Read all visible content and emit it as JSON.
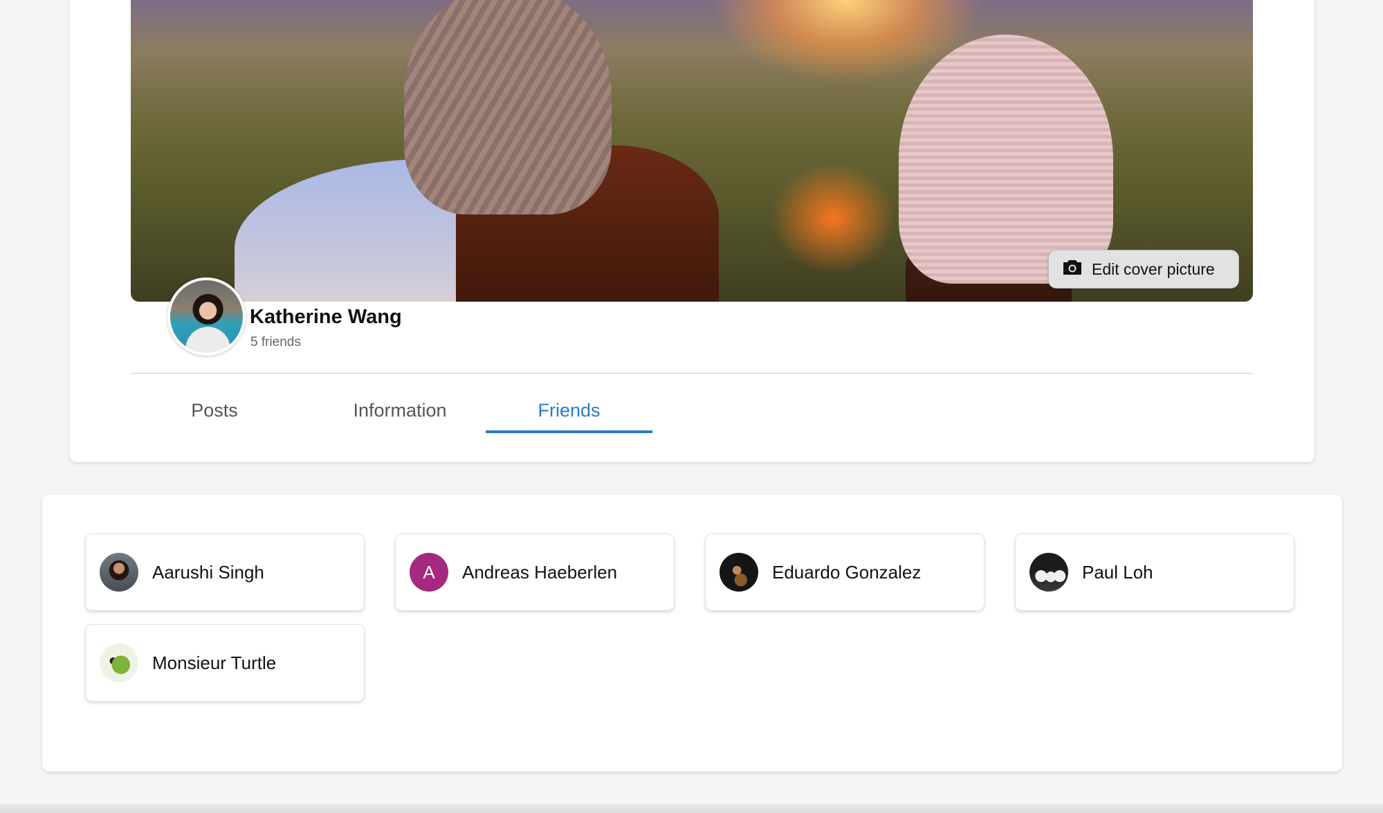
{
  "profile": {
    "name": "Katherine Wang",
    "friend_count": "5 friends",
    "edit_cover_label": "Edit cover picture"
  },
  "tabs": [
    {
      "label": "Posts",
      "active": false
    },
    {
      "label": "Information",
      "active": false
    },
    {
      "label": "Friends",
      "active": true
    }
  ],
  "friends": [
    {
      "name": "Aarushi Singh",
      "avatar": "photo"
    },
    {
      "name": "Andreas Haeberlen",
      "avatar": "initial",
      "initial": "A",
      "avatar_color": "#a5297f"
    },
    {
      "name": "Eduardo Gonzalez",
      "avatar": "photo"
    },
    {
      "name": "Paul Loh",
      "avatar": "photo"
    },
    {
      "name": "Monsieur Turtle",
      "avatar": "photo"
    }
  ],
  "colors": {
    "accent": "#2a7acb",
    "background": "#f5f5f6"
  },
  "icons": {
    "edit_cover": "camera-icon"
  }
}
